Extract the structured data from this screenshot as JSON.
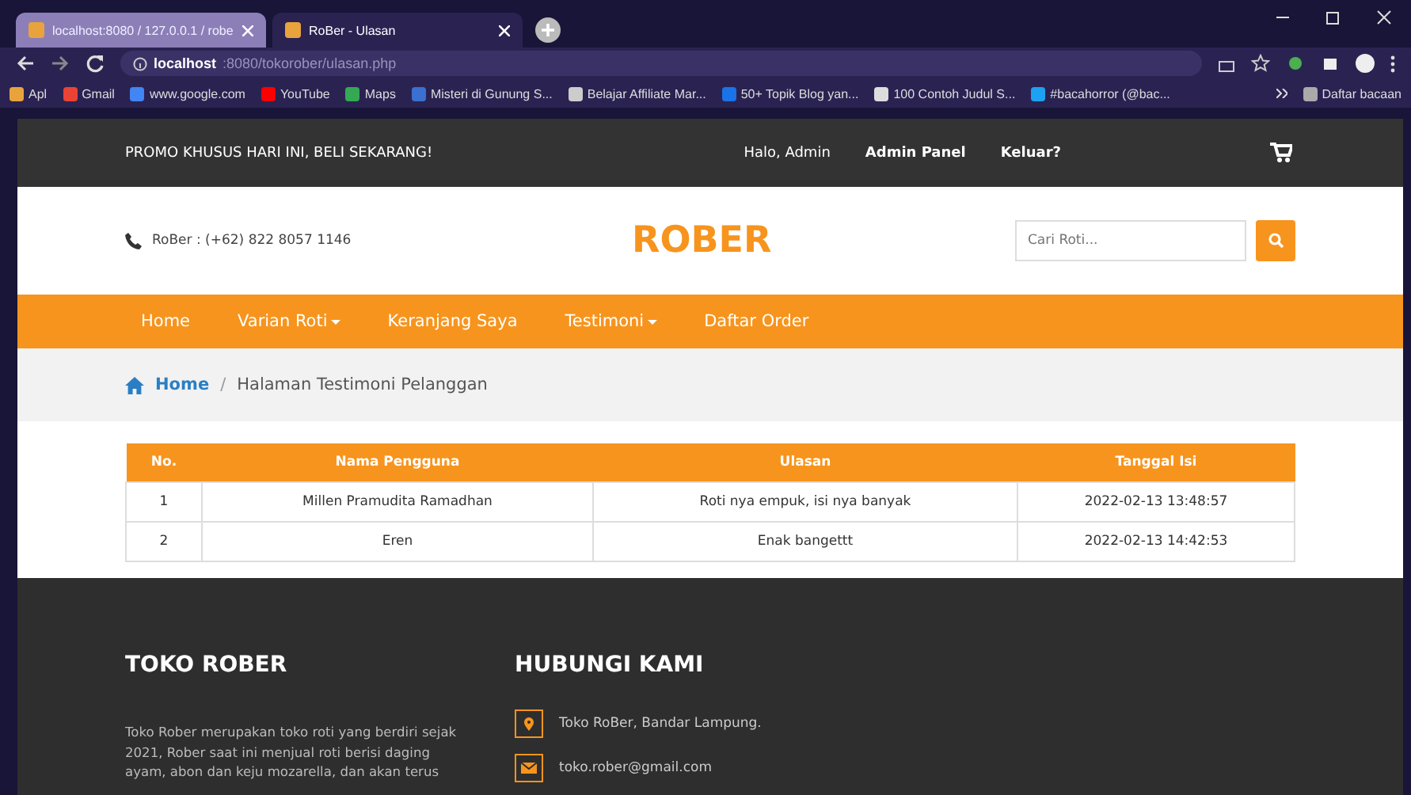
{
  "browser": {
    "tabs": [
      {
        "title": "localhost:8080 / 127.0.0.1 / robe",
        "selected": false
      },
      {
        "title": "RoBer - Ulasan",
        "selected": true
      }
    ],
    "address": {
      "host": "localhost",
      "rest": ":8080/tokorober/ulasan.php"
    },
    "bookmarks": [
      "Apl",
      "Gmail",
      "www.google.com",
      "YouTube",
      "Maps",
      "Misteri di Gunung S...",
      "Belajar Affiliate Mar...",
      "50+ Topik Blog yan...",
      "100 Contoh Judul S...",
      "#bacahorror (@bac..."
    ],
    "reading_list": "Daftar bacaan"
  },
  "topbar": {
    "promo": "PROMO KHUSUS HARI INI, BELI SEKARANG!",
    "greeting": "Halo, Admin",
    "links": [
      "Admin Panel",
      "Keluar?"
    ]
  },
  "header": {
    "phone": "RoBer : (+62) 822 8057 1146",
    "logo": "ROBER",
    "search": {
      "placeholder": "Cari Roti..."
    }
  },
  "nav": [
    {
      "label": "Home",
      "dropdown": false
    },
    {
      "label": "Varian Roti",
      "dropdown": true
    },
    {
      "label": "Keranjang Saya",
      "dropdown": false
    },
    {
      "label": "Testimoni",
      "dropdown": true
    },
    {
      "label": "Daftar Order",
      "dropdown": false
    }
  ],
  "breadcrumb": {
    "home": "Home",
    "separator": "/",
    "current": "Halaman Testimoni Pelanggan"
  },
  "table": {
    "columns": [
      "No.",
      "Nama Pengguna",
      "Ulasan",
      "Tanggal Isi"
    ],
    "rows": [
      [
        "1",
        "Millen Pramudita Ramadhan",
        "Roti nya empuk, isi nya banyak",
        "2022-02-13 13:48:57"
      ],
      [
        "2",
        "Eren",
        "Enak bangettt",
        "2022-02-13 14:42:53"
      ]
    ]
  },
  "footer": {
    "about": {
      "title": "TOKO ROBER",
      "text": "Toko Rober merupakan toko roti yang berdiri sejak 2021, Rober saat ini menjual roti berisi daging ayam, abon dan keju mozarella, dan akan terus"
    },
    "contact": {
      "title": "HUBUNGI KAMI",
      "items": [
        {
          "kind": "location",
          "text": "Toko RoBer, Bandar Lampung."
        },
        {
          "kind": "mail",
          "text": "toko.rober@gmail.com"
        }
      ]
    }
  }
}
